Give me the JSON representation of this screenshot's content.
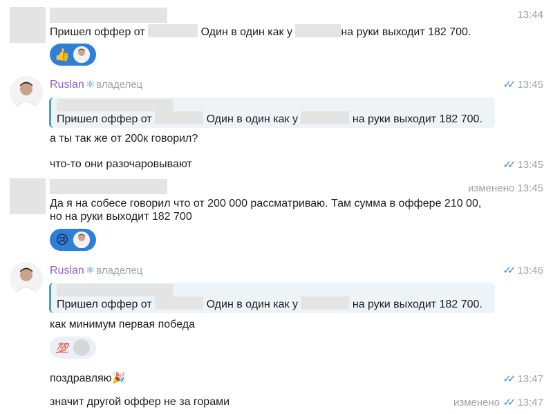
{
  "messages": {
    "m1": {
      "time": "13:44",
      "text_a": "Пришел оффер от",
      "text_b": "Один в один как у",
      "text_c": "на руки выходит 182 700.",
      "reaction_icon": "thumbs-up-icon"
    },
    "m2": {
      "sender": "Ruslan",
      "role": "владелец",
      "time": "13:45",
      "quote": {
        "text_a": "Пришел оффер от",
        "text_b": "Один в один как у",
        "text_c": "на руки выходит 182 700."
      },
      "line1": "а ты так же от 200к говорил?",
      "line2": "что-то они разочаровывают",
      "line2_time": "13:45"
    },
    "m3": {
      "edited": "изменено",
      "time": "13:45",
      "line1": "Да я на собесе говорил что от 200 000 рассматриваю. Там сумма в оффере 210 00,",
      "line2": "но на руки выходит 182 700",
      "reaction_icon": "crying-face-icon"
    },
    "m4": {
      "sender": "Ruslan",
      "role": "владелец",
      "time": "13:46",
      "quote": {
        "text_a": "Пришел оффер от",
        "text_b": "Один в один как у",
        "text_c": "на руки выходит 182 700."
      },
      "line1": "как минимум первая победа",
      "reaction_icon": "hundred-points-icon",
      "line2": "поздравляю",
      "line2_time": "13:47",
      "line3": "значит другой оффер не за горами",
      "line3_edited": "изменено",
      "line3_time": "13:47"
    }
  },
  "colors": {
    "sender": "#8a63d2",
    "checks": "#3b88d4",
    "quote_bar": "#4aa6b2",
    "reaction_active": "#2f7fd9"
  }
}
